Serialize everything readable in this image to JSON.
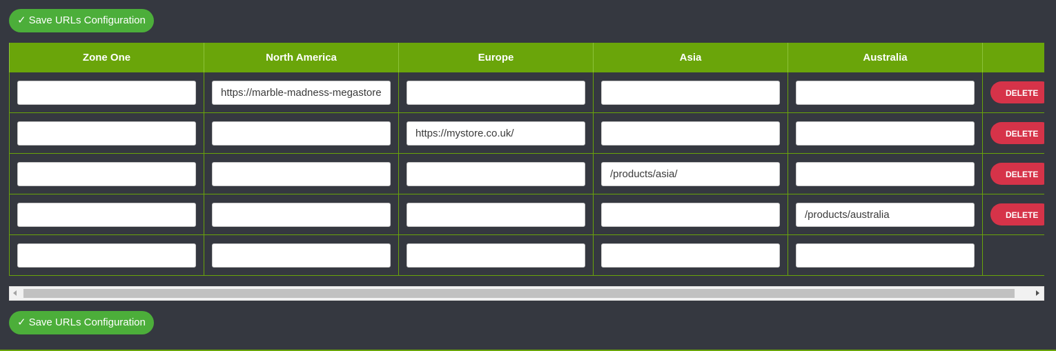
{
  "toolbar": {
    "save_label": "Save URLs Configuration",
    "check_glyph": "✓"
  },
  "table": {
    "headers": [
      "Zone One",
      "North America",
      "Europe",
      "Asia",
      "Australia",
      ""
    ],
    "rows": [
      {
        "values": [
          "",
          "https://marble-madness-megastore",
          "",
          "",
          ""
        ],
        "delete_label": "DELETE"
      },
      {
        "values": [
          "",
          "",
          "https://mystore.co.uk/",
          "",
          ""
        ],
        "delete_label": "DELETE"
      },
      {
        "values": [
          "",
          "",
          "",
          "/products/asia/",
          ""
        ],
        "delete_label": "DELETE"
      },
      {
        "values": [
          "",
          "",
          "",
          "",
          "/products/australia"
        ],
        "delete_label": "DELETE"
      },
      {
        "values": [
          "",
          "",
          "",
          "",
          ""
        ],
        "delete_label": ""
      }
    ]
  },
  "colors": {
    "background": "#353840",
    "header_green": "#6aa50a",
    "save_button": "#4cae3a",
    "delete_button": "#d63349"
  },
  "icons": {
    "check": "check-icon",
    "scroll_left": "chevron-left-icon",
    "scroll_right": "chevron-right-icon"
  }
}
